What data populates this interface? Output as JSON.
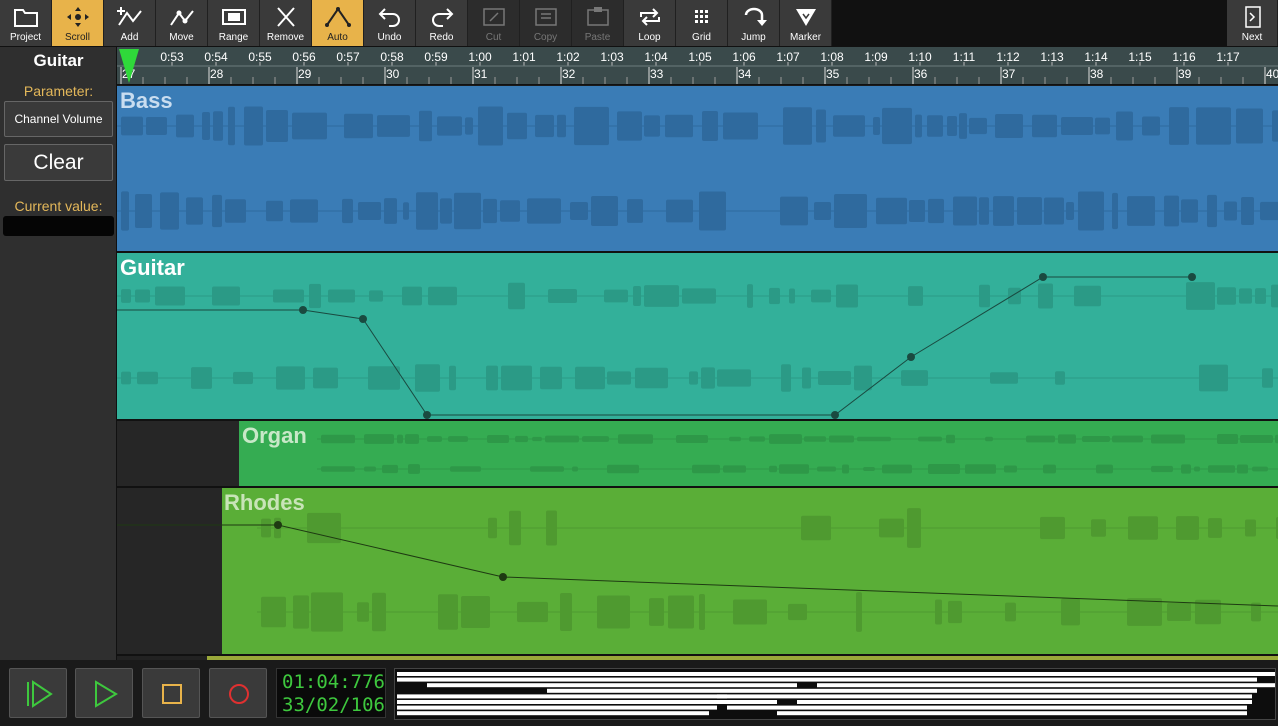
{
  "toolbar": {
    "buttons": [
      {
        "label": "Project",
        "icon": "folder-icon",
        "state": "normal"
      },
      {
        "label": "Scroll",
        "icon": "scroll-icon",
        "state": "active"
      },
      {
        "label": "Add",
        "icon": "add-point-icon",
        "state": "normal"
      },
      {
        "label": "Move",
        "icon": "move-point-icon",
        "state": "normal"
      },
      {
        "label": "Range",
        "icon": "range-icon",
        "state": "normal"
      },
      {
        "label": "Remove",
        "icon": "remove-icon",
        "state": "normal"
      },
      {
        "label": "Auto",
        "icon": "automation-icon",
        "state": "active"
      },
      {
        "label": "Undo",
        "icon": "undo-icon",
        "state": "normal"
      },
      {
        "label": "Redo",
        "icon": "redo-icon",
        "state": "normal"
      },
      {
        "label": "Cut",
        "icon": "cut-icon",
        "state": "disabled"
      },
      {
        "label": "Copy",
        "icon": "copy-icon",
        "state": "disabled"
      },
      {
        "label": "Paste",
        "icon": "paste-icon",
        "state": "disabled"
      },
      {
        "label": "Loop",
        "icon": "loop-icon",
        "state": "normal"
      },
      {
        "label": "Grid",
        "icon": "grid-icon",
        "state": "normal"
      },
      {
        "label": "Jump",
        "icon": "jump-icon",
        "state": "normal"
      },
      {
        "label": "Marker",
        "icon": "marker-icon",
        "state": "normal"
      }
    ],
    "next": {
      "label": "Next",
      "icon": "next-icon"
    }
  },
  "left_panel": {
    "track_name": "Guitar",
    "parameter_label": "Parameter:",
    "parameter_value": "Channel Volume",
    "clear_label": "Clear",
    "current_value_label": "Current value:",
    "current_value": ""
  },
  "ruler": {
    "time_labels": [
      "0:53",
      "0:54",
      "0:55",
      "0:56",
      "0:57",
      "0:58",
      "0:59",
      "1:00",
      "1:01",
      "1:02",
      "1:03",
      "1:04",
      "1:05",
      "1:06",
      "1:07",
      "1:08",
      "1:09",
      "1:10",
      "1:11",
      "1:12",
      "1:13",
      "1:14",
      "1:15",
      "1:16",
      "1:17"
    ],
    "bar_labels": [
      "27",
      "28",
      "29",
      "30",
      "31",
      "32",
      "33",
      "34",
      "35",
      "36",
      "37",
      "38",
      "39",
      "40"
    ],
    "playhead_color": "#2fd93a"
  },
  "tracks": [
    {
      "name": "Bass",
      "color": "#3a7cb6",
      "title_color": "#c9ddf0",
      "wave_color": "#2f6a9e"
    },
    {
      "name": "Guitar",
      "color": "#33b09a",
      "title_color": "#ffffff",
      "wave_color": "#2b9a86"
    },
    {
      "name": "Organ",
      "color": "#35ac52",
      "title_color": "#c8e8c8",
      "wave_color": "#2e9848"
    },
    {
      "name": "Rhodes",
      "color": "#5aae37",
      "title_color": "#c8e4b8",
      "wave_color": "#4f9a30"
    }
  ],
  "transport": {
    "time": "01:04:776",
    "position": "33/02/106",
    "buttons": [
      {
        "name": "play-from-start-button",
        "icon": "play-from-start-icon"
      },
      {
        "name": "play-button",
        "icon": "play-icon"
      },
      {
        "name": "stop-button",
        "icon": "stop-icon"
      },
      {
        "name": "record-button",
        "icon": "record-icon"
      }
    ],
    "accent_green": "#3ec83e",
    "accent_orange": "#e8b34a",
    "accent_red": "#e03030"
  }
}
